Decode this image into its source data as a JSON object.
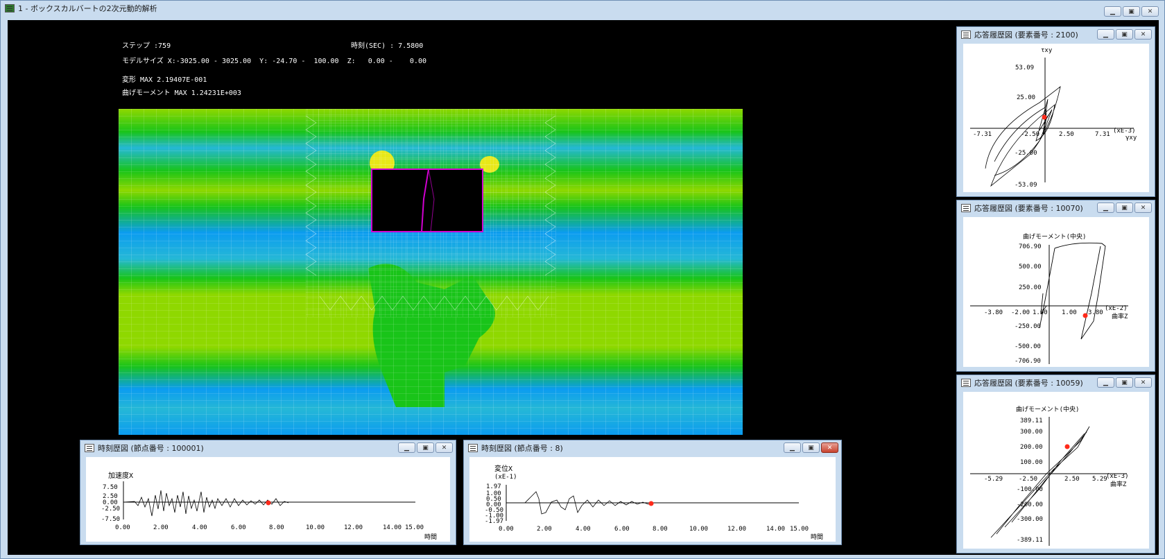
{
  "main": {
    "title": "1 - ボックスカルバートの2次元動的解析",
    "controls": [
      "▁",
      "▣",
      "✕"
    ],
    "info": {
      "step": "ステップ :759",
      "time": "時刻(SEC) : 7.5800",
      "model_size": "モデルサイズ X:-3025.00 - 3025.00  Y: -24.70 -  100.00  Z:   0.00 -    0.00",
      "deform": "変形 MAX 2.19407E-001",
      "moment": "曲げモーメント MAX 1.24231E+003"
    }
  },
  "colors": {
    "background": "#b9cfe6",
    "window_frame": "#c9dcef",
    "canvas": "#000000",
    "mesh_line": "#ffffff",
    "band_green": "#19c419",
    "band_lightgreen": "#8fd800",
    "band_cyan": "#25b8d6",
    "band_blue": "#0b9cf0",
    "band_yellow": "#e8e818",
    "member": "#d000d0",
    "marker": "#ff2a1a"
  },
  "panels": {
    "resp1": {
      "title": "応答履歴図 (要素番号 : 2100)",
      "ylabel": "τxy",
      "xlabel": "γxy",
      "unit": "(xE-3)",
      "y_ticks": [
        "53.09",
        "25.00",
        "-25.00",
        "-53.09"
      ],
      "x_ticks": [
        "-7.31",
        "-2.50",
        "2.50",
        "7.31"
      ]
    },
    "resp2": {
      "title": "応答履歴図 (要素番号 : 10070)",
      "ylabel": "曲げモーメント(中央)",
      "xlabel": "曲率Z",
      "unit": "(xE-2)",
      "y_ticks": [
        "706.90",
        "500.00",
        "250.00",
        "-250.00",
        "-500.00",
        "-706.90"
      ],
      "x_ticks": [
        "-3.80",
        "-2.00",
        "1.00",
        "1.00",
        "3.80"
      ]
    },
    "resp3": {
      "title": "応答履歴図 (要素番号 : 10059)",
      "ylabel": "曲げモーメント(中央)",
      "xlabel": "曲率Z",
      "unit": "(xE-3)",
      "y_ticks": [
        "389.11",
        "300.00",
        "200.00",
        "100.00",
        "-100.00",
        "-200.00",
        "-300.00",
        "-389.11"
      ],
      "x_ticks": [
        "-5.29",
        "-2.50",
        "2.50",
        "5.29"
      ]
    },
    "time1": {
      "title": "時刻歴図 (節点番号 : 100001)",
      "ylabel": "加速度X",
      "xlabel": "時間",
      "y_ticks": [
        "7.50",
        "2.50",
        "0.00",
        "-2.50",
        "-7.50"
      ],
      "x_ticks": [
        "0.00",
        "2.00",
        "4.00",
        "6.00",
        "8.00",
        "10.00",
        "12.00",
        "14.00",
        "15.00"
      ]
    },
    "time2": {
      "title": "時刻歴図 (節点番号 : 8)",
      "ylabel": "変位X",
      "unit": "(xE-1)",
      "xlabel": "時間",
      "y_ticks": [
        "1.97",
        "1.00",
        "0.50",
        "0.00",
        "-0.50",
        "-1.00",
        "-1.97"
      ],
      "x_ticks": [
        "0.00",
        "2.00",
        "4.00",
        "6.00",
        "8.00",
        "10.00",
        "12.00",
        "14.00",
        "15.00"
      ]
    }
  }
}
